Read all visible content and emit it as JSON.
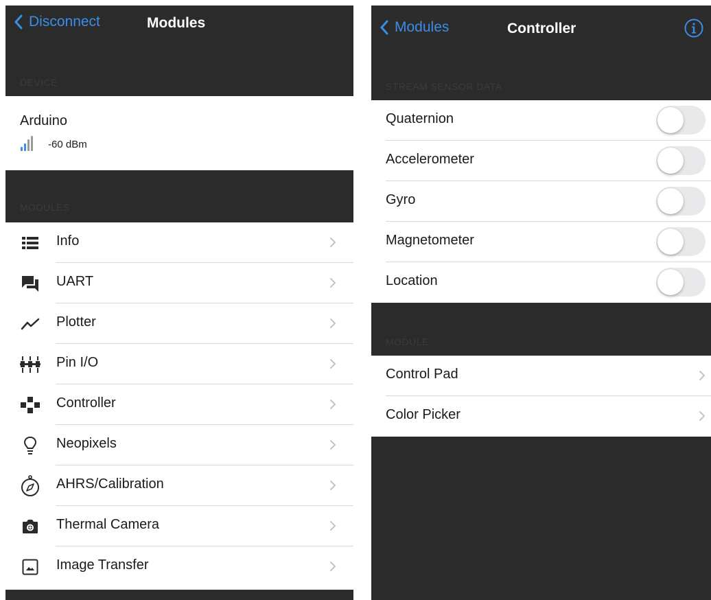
{
  "colors": {
    "accent": "#3a8ee6",
    "dark_bg": "#2b2b2b",
    "separator": "#d9d9d9",
    "chevron": "#c4c4c7"
  },
  "left": {
    "nav": {
      "back_label": "Disconnect",
      "title": "Modules"
    },
    "device_section_header": "DEVICE",
    "device": {
      "name": "Arduino",
      "rssi": "-60 dBm",
      "signal_bars_active": 2,
      "signal_bars_total": 4
    },
    "modules_section_header": "MODULES",
    "modules": [
      {
        "label": "Info",
        "icon": "list-icon"
      },
      {
        "label": "UART",
        "icon": "chat-icon"
      },
      {
        "label": "Plotter",
        "icon": "line-chart-icon"
      },
      {
        "label": "Pin I/O",
        "icon": "pins-icon"
      },
      {
        "label": "Controller",
        "icon": "gamepad-icon"
      },
      {
        "label": "Neopixels",
        "icon": "lightbulb-icon"
      },
      {
        "label": "AHRS/Calibration",
        "icon": "compass-icon"
      },
      {
        "label": "Thermal Camera",
        "icon": "camera-icon"
      },
      {
        "label": "Image Transfer",
        "icon": "image-icon"
      }
    ]
  },
  "right": {
    "nav": {
      "back_label": "Modules",
      "title": "Controller",
      "info_icon": "info-icon"
    },
    "stream_section_header": "STREAM SENSOR DATA",
    "sensors": [
      {
        "label": "Quaternion",
        "enabled": false
      },
      {
        "label": "Accelerometer",
        "enabled": false
      },
      {
        "label": "Gyro",
        "enabled": false
      },
      {
        "label": "Magnetometer",
        "enabled": false
      },
      {
        "label": "Location",
        "enabled": false
      }
    ],
    "module_section_header": "MODULE",
    "module_items": [
      {
        "label": "Control Pad"
      },
      {
        "label": "Color Picker"
      }
    ]
  }
}
